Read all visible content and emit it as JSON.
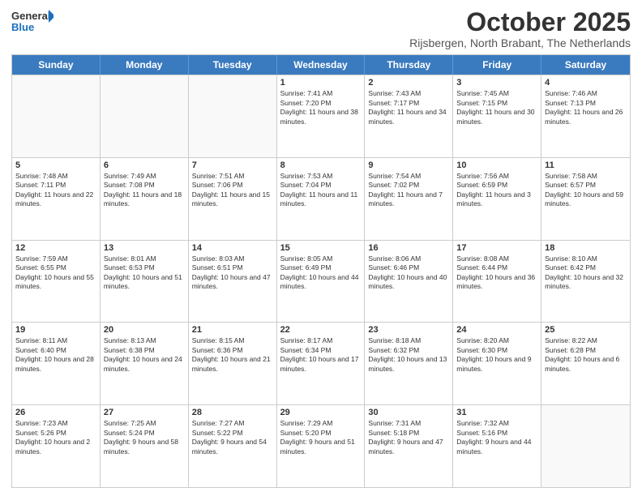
{
  "logo": {
    "text_general": "General",
    "text_blue": "Blue"
  },
  "title": {
    "main": "October 2025",
    "sub": "Rijsbergen, North Brabant, The Netherlands"
  },
  "calendar": {
    "headers": [
      "Sunday",
      "Monday",
      "Tuesday",
      "Wednesday",
      "Thursday",
      "Friday",
      "Saturday"
    ],
    "weeks": [
      [
        {
          "day": "",
          "empty": true
        },
        {
          "day": "",
          "empty": true
        },
        {
          "day": "",
          "empty": true
        },
        {
          "day": "1",
          "sunrise": "7:41 AM",
          "sunset": "7:20 PM",
          "daylight": "11 hours and 38 minutes."
        },
        {
          "day": "2",
          "sunrise": "7:43 AM",
          "sunset": "7:17 PM",
          "daylight": "11 hours and 34 minutes."
        },
        {
          "day": "3",
          "sunrise": "7:45 AM",
          "sunset": "7:15 PM",
          "daylight": "11 hours and 30 minutes."
        },
        {
          "day": "4",
          "sunrise": "7:46 AM",
          "sunset": "7:13 PM",
          "daylight": "11 hours and 26 minutes."
        }
      ],
      [
        {
          "day": "5",
          "sunrise": "7:48 AM",
          "sunset": "7:11 PM",
          "daylight": "11 hours and 22 minutes."
        },
        {
          "day": "6",
          "sunrise": "7:49 AM",
          "sunset": "7:08 PM",
          "daylight": "11 hours and 18 minutes."
        },
        {
          "day": "7",
          "sunrise": "7:51 AM",
          "sunset": "7:06 PM",
          "daylight": "11 hours and 15 minutes."
        },
        {
          "day": "8",
          "sunrise": "7:53 AM",
          "sunset": "7:04 PM",
          "daylight": "11 hours and 11 minutes."
        },
        {
          "day": "9",
          "sunrise": "7:54 AM",
          "sunset": "7:02 PM",
          "daylight": "11 hours and 7 minutes."
        },
        {
          "day": "10",
          "sunrise": "7:56 AM",
          "sunset": "6:59 PM",
          "daylight": "11 hours and 3 minutes."
        },
        {
          "day": "11",
          "sunrise": "7:58 AM",
          "sunset": "6:57 PM",
          "daylight": "10 hours and 59 minutes."
        }
      ],
      [
        {
          "day": "12",
          "sunrise": "7:59 AM",
          "sunset": "6:55 PM",
          "daylight": "10 hours and 55 minutes."
        },
        {
          "day": "13",
          "sunrise": "8:01 AM",
          "sunset": "6:53 PM",
          "daylight": "10 hours and 51 minutes."
        },
        {
          "day": "14",
          "sunrise": "8:03 AM",
          "sunset": "6:51 PM",
          "daylight": "10 hours and 47 minutes."
        },
        {
          "day": "15",
          "sunrise": "8:05 AM",
          "sunset": "6:49 PM",
          "daylight": "10 hours and 44 minutes."
        },
        {
          "day": "16",
          "sunrise": "8:06 AM",
          "sunset": "6:46 PM",
          "daylight": "10 hours and 40 minutes."
        },
        {
          "day": "17",
          "sunrise": "8:08 AM",
          "sunset": "6:44 PM",
          "daylight": "10 hours and 36 minutes."
        },
        {
          "day": "18",
          "sunrise": "8:10 AM",
          "sunset": "6:42 PM",
          "daylight": "10 hours and 32 minutes."
        }
      ],
      [
        {
          "day": "19",
          "sunrise": "8:11 AM",
          "sunset": "6:40 PM",
          "daylight": "10 hours and 28 minutes."
        },
        {
          "day": "20",
          "sunrise": "8:13 AM",
          "sunset": "6:38 PM",
          "daylight": "10 hours and 24 minutes."
        },
        {
          "day": "21",
          "sunrise": "8:15 AM",
          "sunset": "6:36 PM",
          "daylight": "10 hours and 21 minutes."
        },
        {
          "day": "22",
          "sunrise": "8:17 AM",
          "sunset": "6:34 PM",
          "daylight": "10 hours and 17 minutes."
        },
        {
          "day": "23",
          "sunrise": "8:18 AM",
          "sunset": "6:32 PM",
          "daylight": "10 hours and 13 minutes."
        },
        {
          "day": "24",
          "sunrise": "8:20 AM",
          "sunset": "6:30 PM",
          "daylight": "10 hours and 9 minutes."
        },
        {
          "day": "25",
          "sunrise": "8:22 AM",
          "sunset": "6:28 PM",
          "daylight": "10 hours and 6 minutes."
        }
      ],
      [
        {
          "day": "26",
          "sunrise": "7:23 AM",
          "sunset": "5:26 PM",
          "daylight": "10 hours and 2 minutes."
        },
        {
          "day": "27",
          "sunrise": "7:25 AM",
          "sunset": "5:24 PM",
          "daylight": "9 hours and 58 minutes."
        },
        {
          "day": "28",
          "sunrise": "7:27 AM",
          "sunset": "5:22 PM",
          "daylight": "9 hours and 54 minutes."
        },
        {
          "day": "29",
          "sunrise": "7:29 AM",
          "sunset": "5:20 PM",
          "daylight": "9 hours and 51 minutes."
        },
        {
          "day": "30",
          "sunrise": "7:31 AM",
          "sunset": "5:18 PM",
          "daylight": "9 hours and 47 minutes."
        },
        {
          "day": "31",
          "sunrise": "7:32 AM",
          "sunset": "5:16 PM",
          "daylight": "9 hours and 44 minutes."
        },
        {
          "day": "",
          "empty": true
        }
      ]
    ]
  }
}
